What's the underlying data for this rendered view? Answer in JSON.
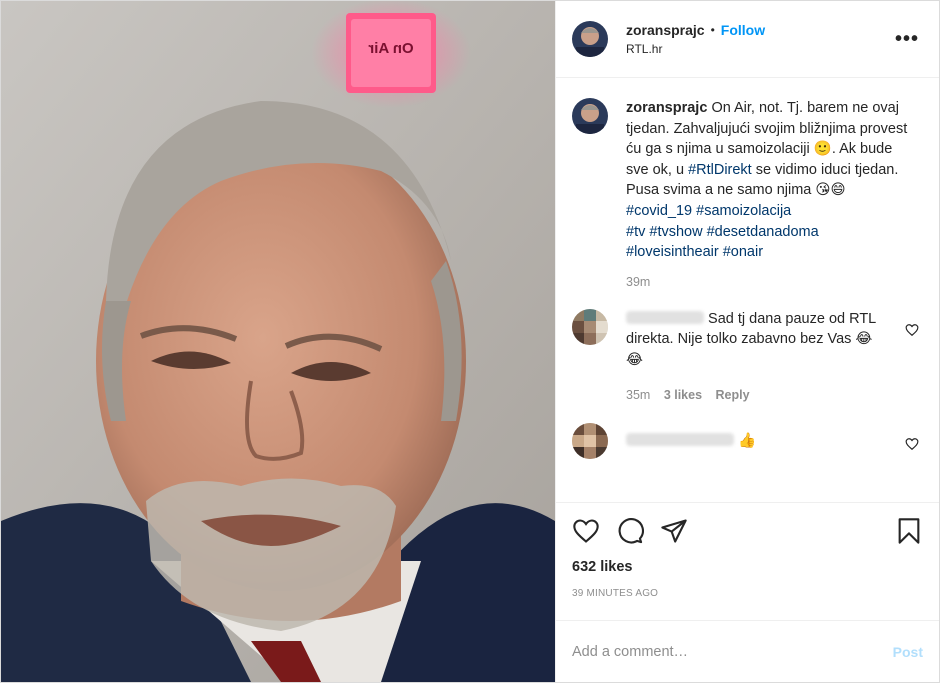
{
  "header": {
    "username": "zoransprajc",
    "dot": "•",
    "follow": "Follow",
    "location": "RTL.hr",
    "more": "•••"
  },
  "photo": {
    "sign_text": "On Air",
    "sign_color": "#ff5a8a"
  },
  "caption": {
    "username": "zoransprajc",
    "part1": "On Air, not. Tj. barem ne ovaj tjedan. Zahvaljujući svojim bližnjima provest ću ga s njima u samoizolaciji 🙂. Ak bude sve ok, u ",
    "tag1": "#RtlDirekt",
    "part2": " se vidimo iduci tjedan. Pusa svima a ne samo njima 😘😄",
    "hashtags": [
      "#covid_19",
      "#samoizolacija",
      "#tv",
      "#tvshow",
      "#desetdanadoma",
      "#loveisintheair",
      "#onair"
    ],
    "time": "39m"
  },
  "comments": [
    {
      "text": "Sad tj dana pauze od RTL direkta. Nije tolko zabavno bez Vas 😂😂",
      "time": "35m",
      "likes": "3 likes",
      "reply": "Reply"
    },
    {
      "text": "👍"
    }
  ],
  "actions": {
    "likes": "632 likes",
    "ago": "39 MINUTES AGO"
  },
  "add_comment": {
    "placeholder": "Add a comment…",
    "post": "Post"
  },
  "colors": {
    "accent": "#0095f6",
    "hashtag": "#00376b",
    "muted": "#8e8e8e"
  }
}
